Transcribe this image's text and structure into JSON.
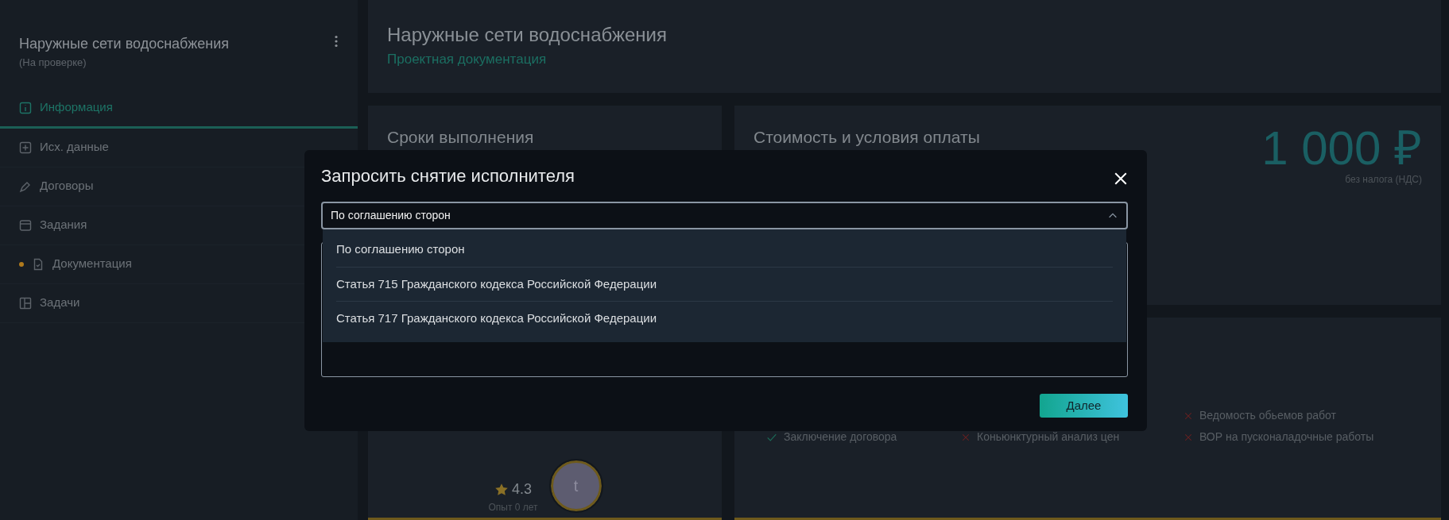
{
  "sidebar": {
    "title": "Наружные сети водоснабжения",
    "status": "(На проверке)",
    "items": [
      {
        "kind": "info",
        "label": "Информация",
        "selected": true,
        "marked": false
      },
      {
        "kind": "source",
        "label": "Исх. данные",
        "selected": false,
        "marked": false
      },
      {
        "kind": "contract",
        "label": "Договоры",
        "selected": false,
        "marked": false
      },
      {
        "kind": "task",
        "label": "Задания",
        "selected": false,
        "marked": false
      },
      {
        "kind": "doc",
        "label": "Документация",
        "selected": false,
        "marked": true
      },
      {
        "kind": "board",
        "label": "Задачи",
        "selected": false,
        "marked": false
      }
    ]
  },
  "header": {
    "title": "Наружные сети водоснабжения",
    "subtitle": "Проектная документация"
  },
  "deadlines": {
    "title": "Сроки выполнения"
  },
  "cost": {
    "title": "Стоимость и условия оплаты",
    "price": "1 000 ₽",
    "tax": "без налога (НДС)"
  },
  "performer": {
    "rating": "4.3",
    "experience": "Опыт 0 лет",
    "initial": "t"
  },
  "checklist": [
    {
      "label": "Заключение договора",
      "done": true
    },
    {
      "label": "Коньюнктурный анализ цен",
      "done": false
    },
    {
      "label": "Ведомость обьемов работ",
      "done": false
    },
    {
      "label": "ВОР на пусконаладочные работы",
      "done": false
    }
  ],
  "modal": {
    "title": "Запросить снятие исполнителя",
    "select": {
      "value": "По соглашению сторон",
      "expanded": true,
      "options": [
        "По соглашению сторон",
        "Статья 715 Гражданского кодекса Российской Федерации",
        "Статья 717 Гражданского кодекса Российской Федерации"
      ]
    },
    "button": "Далее"
  }
}
